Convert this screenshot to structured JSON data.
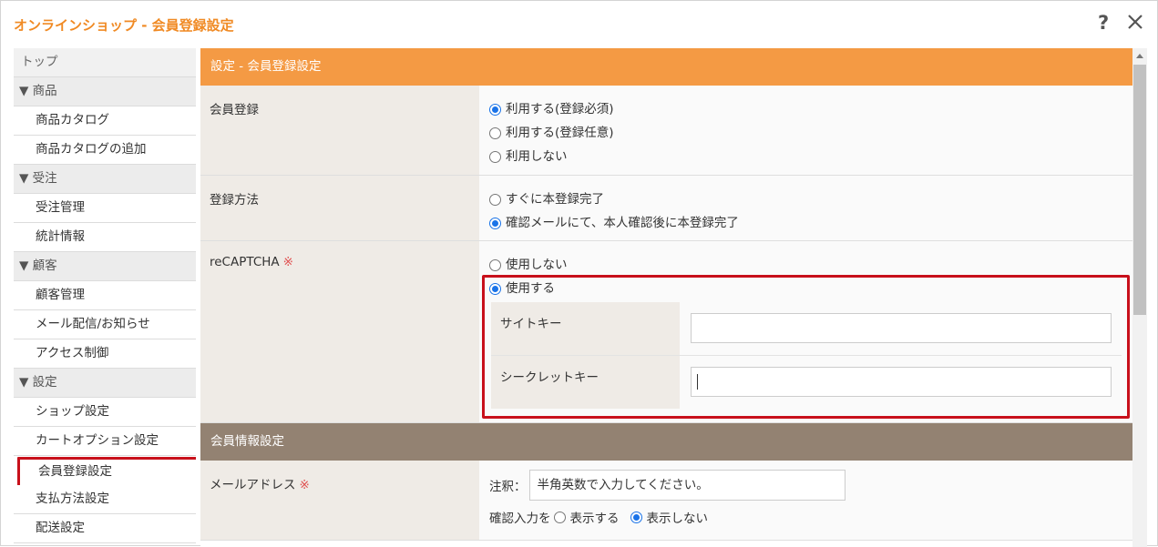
{
  "window": {
    "title": "オンラインショップ - 会員登録設定"
  },
  "sidebar": {
    "top": "トップ",
    "sections": [
      {
        "label": "▼ 商品",
        "items": [
          "商品カタログ",
          "商品カタログの追加"
        ]
      },
      {
        "label": "▼ 受注",
        "items": [
          "受注管理",
          "統計情報"
        ]
      },
      {
        "label": "▼ 顧客",
        "items": [
          "顧客管理",
          "メール配信/お知らせ",
          "アクセス制御"
        ]
      },
      {
        "label": "▼ 設定",
        "items": [
          "ショップ設定",
          "カートオプション設定",
          "会員登録設定",
          "支払方法設定",
          "配送設定"
        ]
      }
    ],
    "active_item": "会員登録設定"
  },
  "main": {
    "section1_title": "設定 - 会員登録設定",
    "member_registration": {
      "label": "会員登録",
      "options": [
        "利用する(登録必須)",
        "利用する(登録任意)",
        "利用しない"
      ],
      "selected": 0
    },
    "registration_method": {
      "label": "登録方法",
      "options": [
        "すぐに本登録完了",
        "確認メールにて、本人確認後に本登録完了"
      ],
      "selected": 1
    },
    "recaptcha": {
      "label": "reCAPTCHA",
      "required_mark": "※",
      "options": [
        "使用しない",
        "使用する"
      ],
      "selected": 1,
      "site_key_label": "サイトキー",
      "site_key_value": "",
      "secret_key_label": "シークレットキー",
      "secret_key_value": ""
    },
    "section2_title": "会員情報設定",
    "email": {
      "label": "メールアドレス",
      "required_mark": "※",
      "note_label": "注釈：",
      "note_value": "半角英数で入力してください。",
      "confirm_label": "確認入力を",
      "confirm_options": [
        "表示する",
        "表示しない"
      ],
      "confirm_selected": 1
    }
  },
  "colors": {
    "accent": "#f08a24",
    "section_orange": "#f49a44",
    "section_brown": "#938272",
    "highlight": "#c8101b",
    "radio": "#1a73e8"
  }
}
